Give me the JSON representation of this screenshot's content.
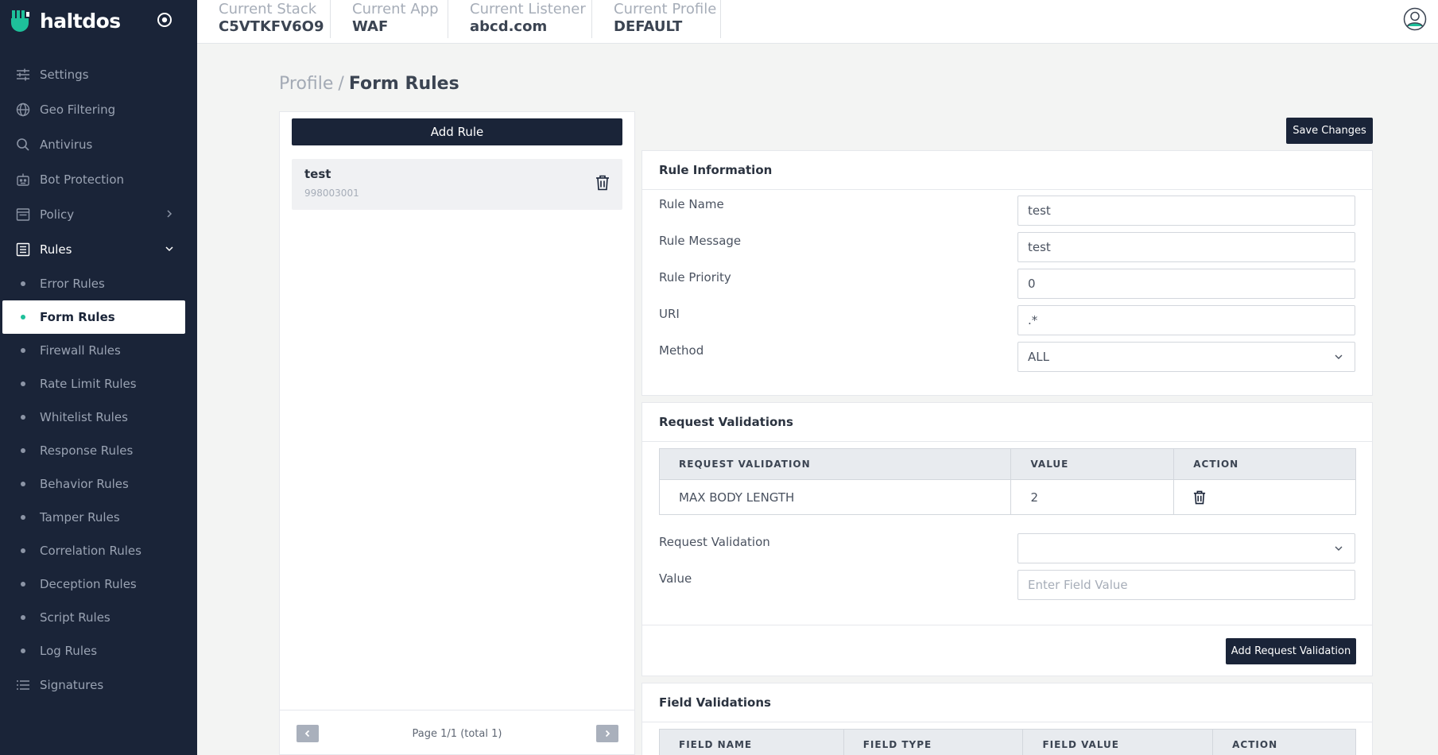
{
  "brand": {
    "name": "haltdos"
  },
  "colors": {
    "sidebar_bg": "#1a2438",
    "accent": "#1ec09a",
    "primary_button": "#1a2438"
  },
  "sidebar": {
    "items": [
      {
        "label": "Settings",
        "icon": "sliders-icon"
      },
      {
        "label": "Geo Filtering",
        "icon": "globe-icon"
      },
      {
        "label": "Antivirus",
        "icon": "search-icon"
      },
      {
        "label": "Bot Protection",
        "icon": "robot-icon"
      },
      {
        "label": "Policy",
        "icon": "policy-icon"
      },
      {
        "label": "Rules",
        "icon": "rules-icon"
      }
    ],
    "rules_sub": [
      "Error Rules",
      "Form Rules",
      "Firewall Rules",
      "Rate Limit Rules",
      "Whitelist Rules",
      "Response Rules",
      "Behavior Rules",
      "Tamper Rules",
      "Correlation Rules",
      "Deception Rules",
      "Script Rules",
      "Log Rules"
    ],
    "active_sub": "Form Rules",
    "signatures": {
      "label": "Signatures",
      "icon": "list-icon"
    }
  },
  "topbar": {
    "contexts": [
      {
        "label": "Current Stack",
        "value": "C5VTKFV6O9"
      },
      {
        "label": "Current App",
        "value": "WAF"
      },
      {
        "label": "Current Listener",
        "value": "abcd.com"
      },
      {
        "label": "Current Profile",
        "value": "DEFAULT"
      }
    ]
  },
  "breadcrumb": {
    "root": "Profile",
    "separator": "/",
    "current": "Form Rules"
  },
  "rule_list": {
    "add_label": "Add Rule",
    "items": [
      {
        "name": "test",
        "id": "998003001"
      }
    ],
    "pager_text": "Page 1/1 (total 1)"
  },
  "save_label": "Save Changes",
  "rule_info": {
    "title": "Rule Information",
    "fields": [
      {
        "label": "Rule Name",
        "value": "test"
      },
      {
        "label": "Rule Message",
        "value": "test"
      },
      {
        "label": "Rule Priority",
        "value": "0"
      },
      {
        "label": "URI",
        "value": ".*"
      }
    ],
    "method": {
      "label": "Method",
      "value": "ALL"
    }
  },
  "request_validations": {
    "title": "Request Validations",
    "columns": [
      "REQUEST VALIDATION",
      "VALUE",
      "ACTION"
    ],
    "rows": [
      {
        "name": "MAX BODY LENGTH",
        "value": "2"
      }
    ],
    "select_label": "Request Validation",
    "select_value": "",
    "value_label": "Value",
    "value_placeholder": "Enter Field Value",
    "add_label": "Add Request Validation"
  },
  "field_validations": {
    "title": "Field Validations",
    "columns": [
      "FIELD NAME",
      "FIELD TYPE",
      "FIELD VALUE",
      "ACTION"
    ]
  }
}
